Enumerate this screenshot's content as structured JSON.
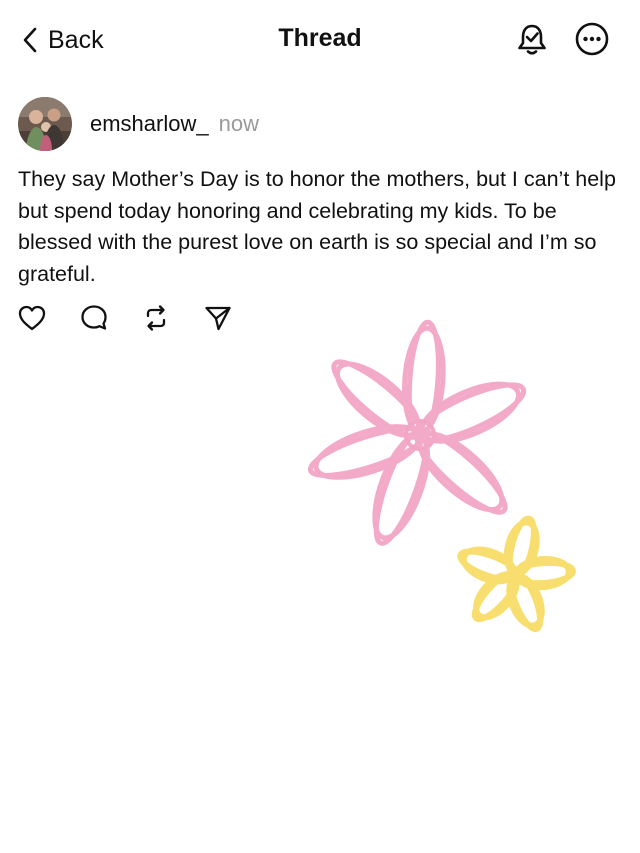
{
  "nav": {
    "back_label": "Back",
    "title": "Thread",
    "icons": [
      "chevron-left-icon",
      "bell-icon",
      "more-icon"
    ]
  },
  "post": {
    "username": "emsharlow_",
    "timestamp": "now",
    "text": "They say Mother’s Day is to honor the mothers, but I can’t help but spend today honoring and celebrating my kids. To be blessed with the purest love on earth is so special and I’m so grateful.",
    "action_icons": [
      "heart-icon",
      "comment-icon",
      "repost-icon",
      "share-icon"
    ]
  },
  "colors": {
    "text": "#111111",
    "secondary_text": "#9a9a9a",
    "flower_pink": "#f2a6c6",
    "flower_yellow": "#f8de6e"
  }
}
